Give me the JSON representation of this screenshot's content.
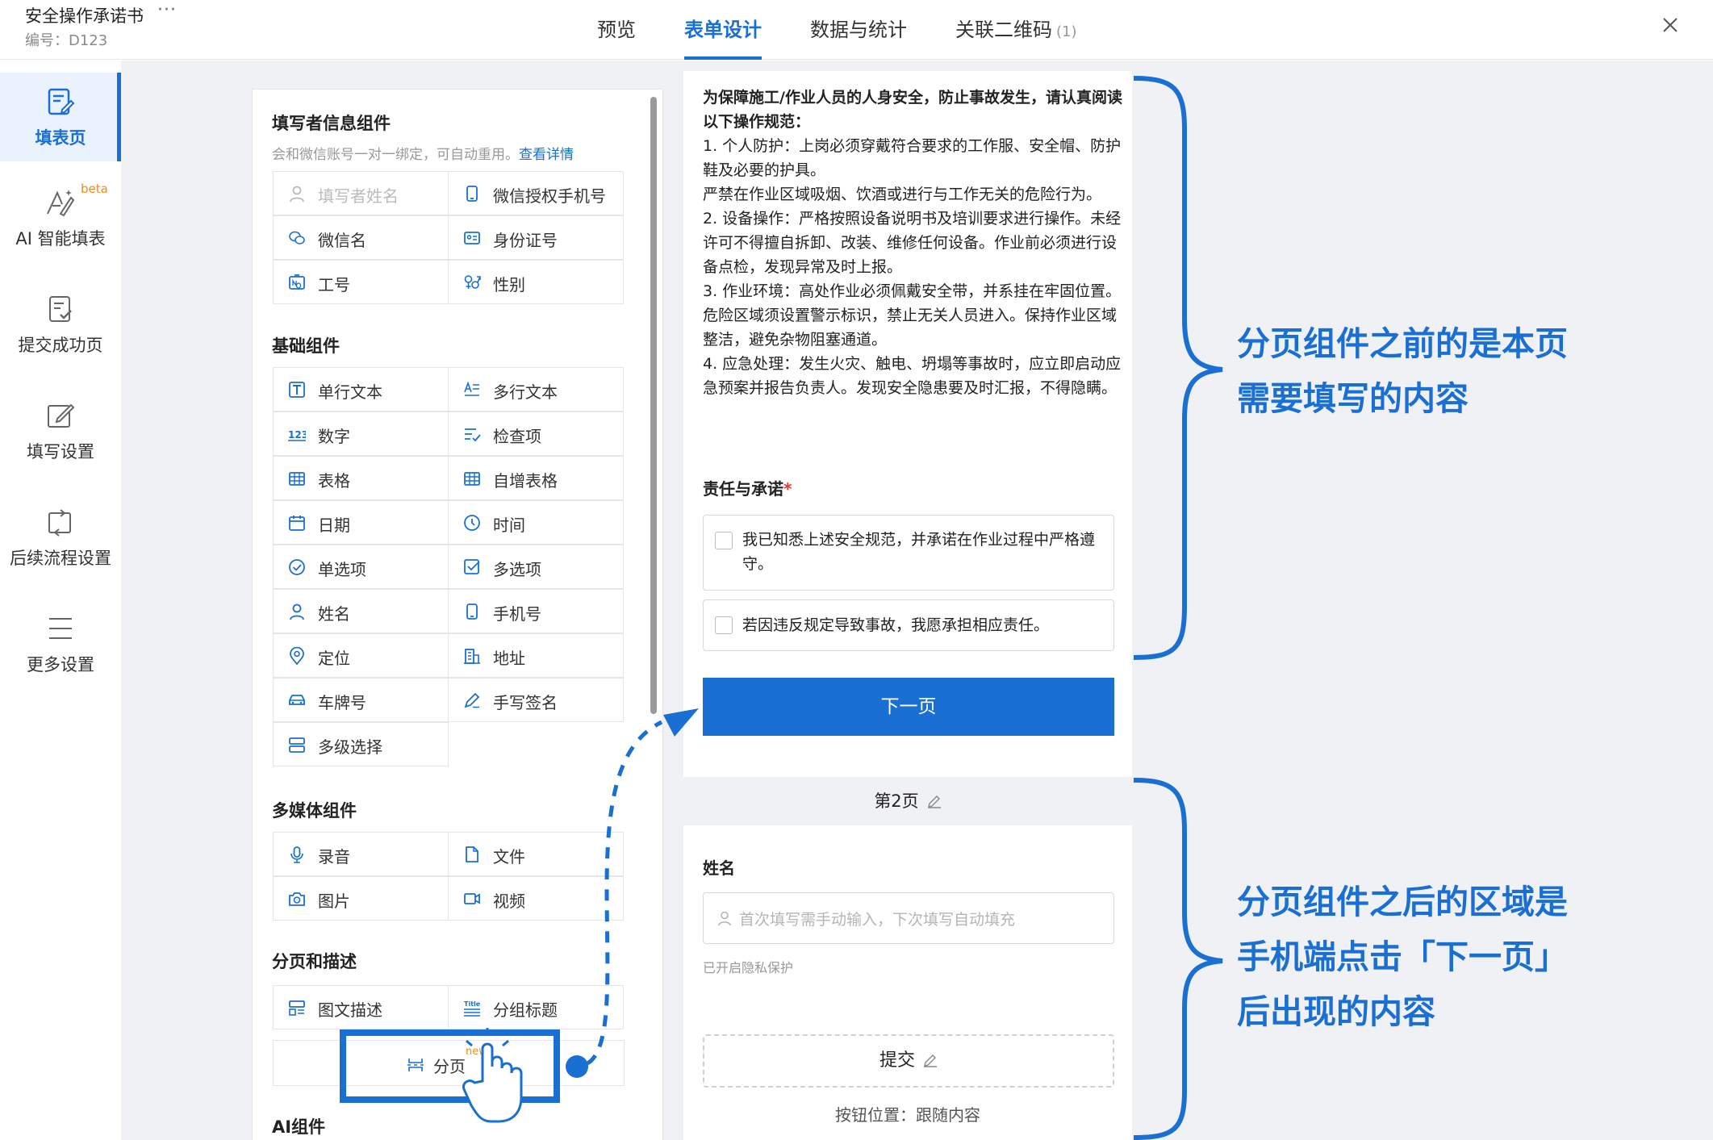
{
  "header": {
    "doc_title": "安全操作承诺书",
    "more": "···",
    "doc_code": "编号：D123",
    "tabs": [
      {
        "label": "预览"
      },
      {
        "label": "表单设计"
      },
      {
        "label": "数据与统计"
      },
      {
        "label": "关联二维码",
        "count": "(1)"
      }
    ],
    "active_tab": "表单设计"
  },
  "leftnav": {
    "items": [
      {
        "label": "填表页",
        "icon": "form-page-icon",
        "active": true
      },
      {
        "label": "AI 智能填表",
        "icon": "ai-fill-icon",
        "badge": "beta"
      },
      {
        "label": "提交成功页",
        "icon": "submit-success-icon"
      },
      {
        "label": "填写设置",
        "icon": "edit-settings-icon"
      },
      {
        "label": "后续流程设置",
        "icon": "workflow-icon"
      },
      {
        "label": "更多设置",
        "icon": "menu-icon"
      }
    ]
  },
  "components": {
    "filler_title": "填写者信息组件",
    "filler_desc": "会和微信账号一对一绑定，可自动重用。",
    "filler_link": "查看详情",
    "filler_items": [
      {
        "label": "填写者姓名",
        "icon": "user-icon"
      },
      {
        "label": "微信授权手机号",
        "icon": "phone-icon"
      },
      {
        "label": "微信名",
        "icon": "wechat-icon"
      },
      {
        "label": "身份证号",
        "icon": "id-card-icon"
      },
      {
        "label": "工号",
        "icon": "employee-no-icon"
      },
      {
        "label": "性别",
        "icon": "gender-icon"
      }
    ],
    "basic_title": "基础组件",
    "basic_items": [
      {
        "label": "单行文本",
        "icon": "text-icon"
      },
      {
        "label": "多行文本",
        "icon": "multiline-text-icon"
      },
      {
        "label": "数字",
        "icon": "number-icon"
      },
      {
        "label": "检查项",
        "icon": "checklist-icon"
      },
      {
        "label": "表格",
        "icon": "table-icon"
      },
      {
        "label": "自增表格",
        "icon": "auto-table-icon"
      },
      {
        "label": "日期",
        "icon": "calendar-icon"
      },
      {
        "label": "时间",
        "icon": "clock-icon"
      },
      {
        "label": "单选项",
        "icon": "radio-icon"
      },
      {
        "label": "多选项",
        "icon": "checkbox-icon"
      },
      {
        "label": "姓名",
        "icon": "user-icon"
      },
      {
        "label": "手机号",
        "icon": "phone-icon"
      },
      {
        "label": "定位",
        "icon": "location-icon"
      },
      {
        "label": "地址",
        "icon": "building-icon"
      },
      {
        "label": "车牌号",
        "icon": "car-icon"
      },
      {
        "label": "手写签名",
        "icon": "signature-icon"
      },
      {
        "label": "多级选择",
        "icon": "cascade-icon"
      }
    ],
    "media_title": "多媒体组件",
    "media_items": [
      {
        "label": "录音",
        "icon": "microphone-icon"
      },
      {
        "label": "文件",
        "icon": "file-icon"
      },
      {
        "label": "图片",
        "icon": "camera-icon"
      },
      {
        "label": "视频",
        "icon": "video-icon"
      }
    ],
    "paging_title": "分页和描述",
    "paging_items": [
      {
        "label": "图文描述",
        "icon": "image-text-icon"
      },
      {
        "label": "分组标题",
        "icon": "group-title-icon"
      }
    ],
    "pagination_label": "分页",
    "pagination_badge": "new",
    "ai_title": "AI组件"
  },
  "form": {
    "intro_lead": "为保障施工/作业人员的人身安全，防止事故发生，请认真阅读以下操作规范：",
    "intro_lines": [
      "1. 个人防护：上岗必须穿戴符合要求的工作服、安全帽、防护鞋及必要的护具。",
      "严禁在作业区域吸烟、饮酒或进行与工作无关的危险行为。",
      "2. 设备操作：严格按照设备说明书及培训要求进行操作。未经许可不得擅自拆卸、改装、维修任何设备。作业前必须进行设备点检，发现异常及时上报。",
      "3. 作业环境：高处作业必须佩戴安全带，并系挂在牢固位置。危险区域须设置警示标识，禁止无关人员进入。保持作业区域整洁，避免杂物阻塞通道。",
      "4. 应急处理：发生火灾、触电、坍塌等事故时，应立即启动应急预案并报告负责人。发现安全隐患要及时汇报，不得隐瞒。"
    ],
    "responsibility_title": "责任与承诺",
    "required_mark": "*",
    "options": [
      "我已知悉上述安全规范，并承诺在作业过程中严格遵守。",
      "若因违反规定导致事故，我愿承担相应责任。"
    ],
    "next_button": "下一页",
    "page2_label": "第2页",
    "name_label": "姓名",
    "name_placeholder": "首次填写需手动输入，下次填写自动填充",
    "privacy_note": "已开启隐私保护",
    "submit_button": "提交",
    "button_position": "按钮位置：跟随内容"
  },
  "annotations": {
    "upper": [
      "分页组件之前的是本页",
      "需要填写的内容"
    ],
    "lower": [
      "分页组件之后的区域是",
      "手机端点击「下一页」",
      "后出现的内容"
    ]
  },
  "colors": {
    "accent": "#1a6fd2",
    "required": "#e53935",
    "beta": "#f08c1b"
  }
}
